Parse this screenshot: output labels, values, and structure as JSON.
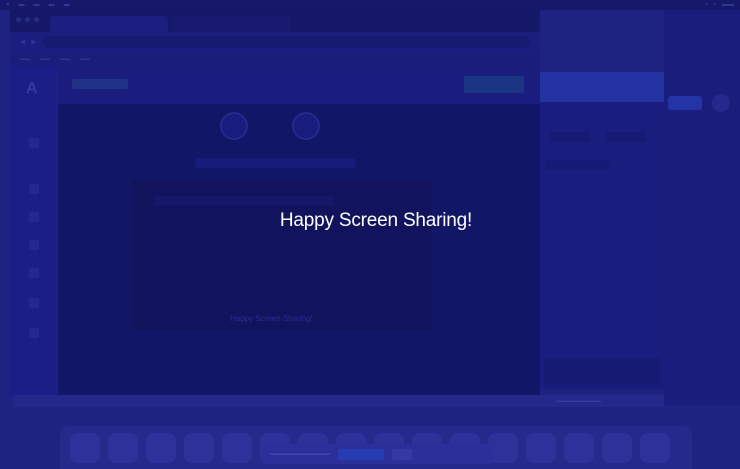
{
  "overlay": {
    "message": "Happy Screen Sharing!"
  },
  "background_app": {
    "ghost_text": "Happy Screen Sharing!"
  },
  "colors": {
    "dim_overlay": "#23278a",
    "banner_text": "#ffffff"
  }
}
